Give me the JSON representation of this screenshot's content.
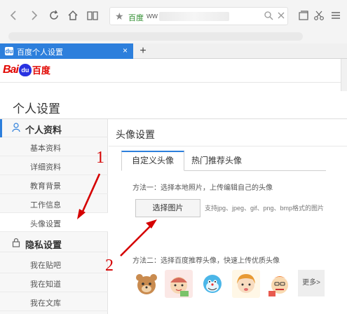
{
  "browser": {
    "site_label": "百度",
    "url_prefix": "ww",
    "tab_title": "百度个人设置",
    "tab_close": "×",
    "new_tab": "+"
  },
  "logo": {
    "bai": "Bai",
    "du": "du",
    "cn": "百度"
  },
  "page": {
    "title": "个人设置"
  },
  "sidebar": {
    "section_profile": "个人资料",
    "profile_items": [
      "基本资料",
      "详细资料",
      "教育背景",
      "工作信息",
      "头像设置"
    ],
    "section_privacy": "隐私设置",
    "privacy_items": [
      "我在贴吧",
      "我在知道",
      "我在文库"
    ]
  },
  "main": {
    "title": "头像设置",
    "tab_custom": "自定义头像",
    "tab_recommended": "热门推荐头像",
    "method1": "方法一：选择本地照片，上传编辑自己的头像",
    "choose_button": "选择图片",
    "hint": "支持jpg、jpeg、gif、png、bmp格式的图片",
    "method2": "方法二：选择百度推荐头像，快速上传优质头像",
    "more": "更多>"
  },
  "annotations": {
    "label_1": "1",
    "label_2": "2",
    "color": "#d50000"
  },
  "colors": {
    "accent": "#2d7fdc",
    "baidu_red": "#e10601",
    "baidu_blue": "#2932e1"
  }
}
